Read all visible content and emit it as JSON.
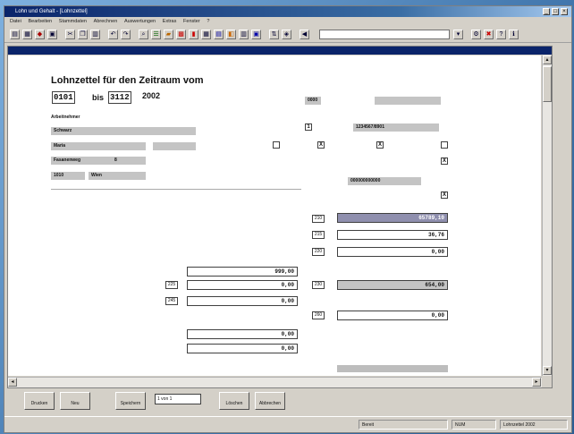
{
  "window": {
    "title": "Lohn und Gehalt - [Lohnzettel]"
  },
  "menu": [
    "Datei",
    "Bearbeiten",
    "Stammdaten",
    "Abrechnen",
    "Auswertungen",
    "Extras",
    "Fenster",
    "?"
  ],
  "form": {
    "heading": "Lohnzettel für den Zeitraum vom",
    "from_date": "0101",
    "to_label": "bis",
    "to_date": "3112",
    "year": "2002",
    "employee_name": "Schwarz",
    "first_name": "Maria",
    "street": "Fasanenweg",
    "house_no": "8",
    "zip": "1010",
    "city": "Wien",
    "sv_number": "0000",
    "tax_number": "1234567/8901",
    "tax_office": "000000000000",
    "amounts": {
      "gross": "65789,10",
      "line2": "36,76",
      "line3": "0,00",
      "deduct1": "999,00",
      "deduct2": "0,00",
      "deduct3": "0,00",
      "mid": "654,00",
      "line_low": "0,00",
      "x1": "0,00",
      "x2": "0,00"
    },
    "codes": {
      "c210": "210",
      "c215": "215",
      "c220": "220",
      "c225": "225",
      "c230": "230",
      "c245": "245",
      "c260": "260"
    }
  },
  "buttons": [
    "Drucken",
    "Neu",
    "Speichern",
    "Löschen",
    "Abbrechen"
  ],
  "page_field": "1 von 1",
  "status": {
    "left": "Bereit",
    "mid": "NUM",
    "right": "Lohnzettel 2002"
  },
  "icons": [
    "new-icon",
    "open-icon",
    "save-icon",
    "print-icon",
    "cut-icon",
    "copy-icon",
    "paste-icon",
    "undo-icon",
    "calc-icon",
    "help-icon"
  ]
}
